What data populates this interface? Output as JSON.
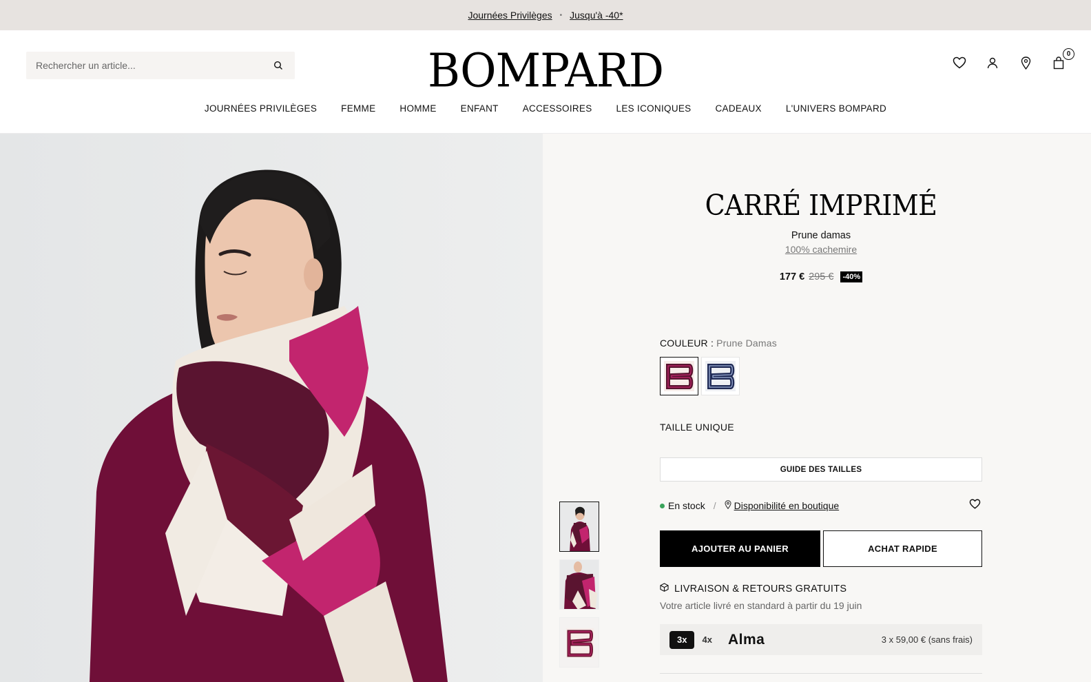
{
  "promo": {
    "link1": "Journées Privilèges",
    "separator": "•",
    "link2": "Jusqu'à -40*"
  },
  "header": {
    "search_placeholder": "Rechercher un article...",
    "logo": "BOMPARD",
    "cart_count": "0",
    "icons": [
      "search-icon",
      "heart-icon",
      "user-icon",
      "location-pin-icon",
      "bag-icon"
    ]
  },
  "nav": {
    "items": [
      "JOURNÉES PRIVILÈGES",
      "FEMME",
      "HOMME",
      "ENFANT",
      "ACCESSOIRES",
      "LES ICONIQUES",
      "CADEAUX",
      "L'UNIVERS BOMPARD"
    ]
  },
  "product": {
    "title": "CARRÉ IMPRIMÉ",
    "color_name": "Prune damas",
    "material": "100% cachemire",
    "price": "177 €",
    "old_price": "295 €",
    "discount": "-40%",
    "color_label": "COULEUR :",
    "color_value": "Prune Damas",
    "size_label": "TAILLE UNIQUE",
    "size_guide": "GUIDE DES TAILLES",
    "stock": "En stock",
    "slash": "/",
    "store_availability": "Disponibilité en boutique",
    "add_to_cart": "AJOUTER AU PANIER",
    "quick_buy": "ACHAT RAPIDE",
    "shipping_title": "LIVRAISON & RETOURS GRATUITS",
    "shipping_sub": "Votre article livré en standard à partir du 19 juin"
  },
  "alma": {
    "opt3": "3x",
    "opt4": "4x",
    "brand": "Alma",
    "installment": "3 x 59,00 € (sans frais)"
  },
  "colors": {
    "accent": "#000000",
    "banner_bg": "#e7e3e0",
    "panel_bg": "#f8f7f5",
    "stock_green": "#3aa35a",
    "scarf_plum": "#6b1633",
    "scarf_magenta": "#c2256e",
    "sweater": "#6f0f38"
  }
}
